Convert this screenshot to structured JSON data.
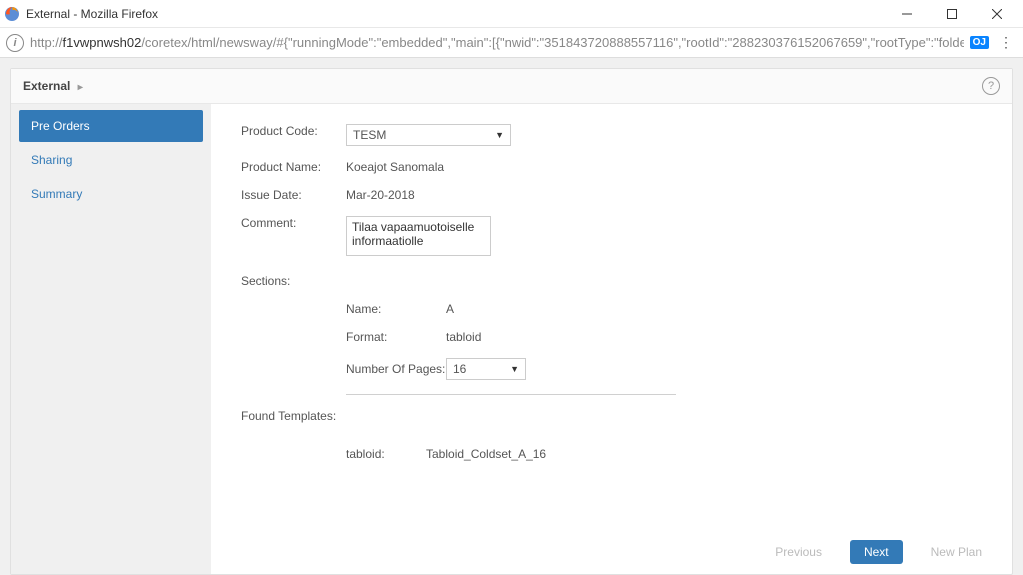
{
  "window": {
    "title": "External - Mozilla Firefox"
  },
  "address": {
    "prefix": "http://",
    "host": "f1vwpnwsh02",
    "path": "/coretex/html/newsway/#{\"runningMode\":\"embedded\",\"main\":[{\"nwid\":\"351843720888557116\",\"rootId\":\"288230376152067659\",\"rootType\":\"folder\",\"viewClass\":\"P",
    "badge": "OJ"
  },
  "breadcrumb": {
    "label": "External"
  },
  "sidebar": {
    "items": [
      {
        "label": "Pre Orders",
        "active": true
      },
      {
        "label": "Sharing",
        "active": false
      },
      {
        "label": "Summary",
        "active": false
      }
    ]
  },
  "form": {
    "labels": {
      "product_code": "Product Code:",
      "product_name": "Product Name:",
      "issue_date": "Issue Date:",
      "comment": "Comment:",
      "sections": "Sections:",
      "found_templates": "Found Templates:"
    },
    "product_code": "TESM",
    "product_name": "Koeajot Sanomala",
    "issue_date": "Mar-20-2018",
    "comment": "Tilaa vapaamuotoiselle informaatiolle "
  },
  "section": {
    "labels": {
      "name": "Name:",
      "format": "Format:",
      "num_pages": "Number Of Pages:"
    },
    "name": "A",
    "format": "tabloid",
    "num_pages": "16"
  },
  "templates": {
    "label": "tabloid:",
    "value": "Tabloid_Coldset_A_16"
  },
  "footer": {
    "previous": "Previous",
    "next": "Next",
    "new_plan": "New Plan"
  }
}
